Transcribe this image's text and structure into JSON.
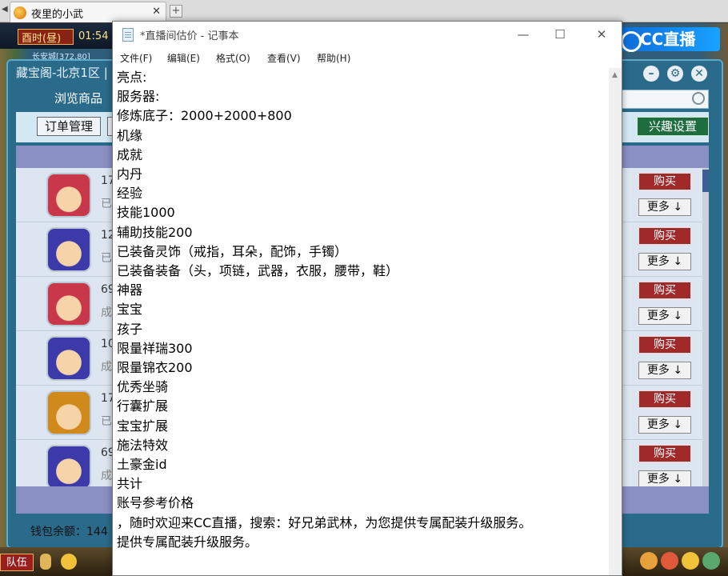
{
  "browser": {
    "tab_title": "夜里的小武",
    "tab_close": "✕",
    "new_tab": "+"
  },
  "game": {
    "time_label": "酉时(昼)",
    "clock": "01:54",
    "coords": "长安城[372,80]",
    "cc_logo": "CC直播",
    "team_button": "队伍"
  },
  "panel": {
    "title": "藏宝阁-北京1区 |",
    "browse_tab": "浏览商品",
    "order_button": "订单管理",
    "interest_button": "兴趣设置",
    "wallet": "钱包余额：144",
    "rows": [
      {
        "num": "17",
        "status": "已",
        "buy": "购买",
        "more": "更多 ↓",
        "avatar": "red-hair-hero",
        "color": "#c9384a"
      },
      {
        "num": "12",
        "status": "已",
        "buy": "购买",
        "more": "更多 ↓",
        "avatar": "blue-hair-hero",
        "color": "#3b3aa8"
      },
      {
        "num": "69",
        "status": "成",
        "buy": "购买",
        "more": "更多 ↓",
        "avatar": "red-hair-girl",
        "color": "#c9384a"
      },
      {
        "num": "10",
        "status": "成",
        "buy": "购买",
        "more": "更多 ↓",
        "avatar": "blue-hair-hero",
        "color": "#3b3aa8"
      },
      {
        "num": "17",
        "status": "已",
        "buy": "购买",
        "more": "更多 ↓",
        "avatar": "tiger-hero",
        "color": "#d08a1c"
      },
      {
        "num": "69",
        "status": "成",
        "buy": "购买",
        "more": "更多 ↓",
        "avatar": "blue-hair-hero",
        "color": "#3b3aa8"
      }
    ]
  },
  "notepad": {
    "title": "*直播间估价 - 记事本",
    "controls": {
      "minimize": "—",
      "maximize": "☐",
      "close": "✕"
    },
    "menu": [
      "文件(F)",
      "编辑(E)",
      "格式(O)",
      "查看(V)",
      "帮助(H)"
    ],
    "lines": [
      "亮点:",
      "服务器:",
      "修炼底子：2000+2000+800",
      "机缘",
      "成就",
      "内丹",
      "经验",
      "技能1000",
      "辅助技能200",
      "已装备灵饰（戒指，耳朵，配饰，手镯）",
      "已装备装备（头，项链，武器，衣服，腰带，鞋）",
      "神器",
      "宝宝",
      "孩子",
      "限量祥瑞300",
      "限量锦衣200",
      "优秀坐骑",
      "行囊扩展",
      "宝宝扩展",
      "施法特效",
      "土豪金id",
      "共计",
      "账号参考价格",
      "，随时欢迎来CC直播，搜索：好兄弟武林，为您提供专属配装升级服务。",
      "提供专属配装升级服务。"
    ]
  }
}
